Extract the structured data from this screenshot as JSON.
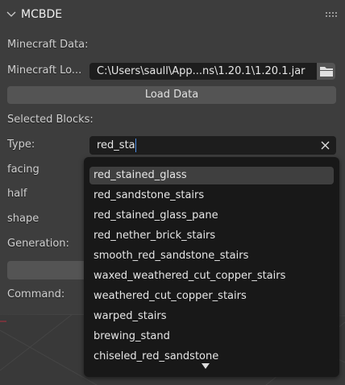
{
  "panel": {
    "title": "MCBDE"
  },
  "minecraft_data_label": "Minecraft Data:",
  "location": {
    "label": "Minecraft Lo...",
    "value": "C:\\Users\\saull\\App...ns\\1.20.1\\1.20.1.jar"
  },
  "load_button": "Load Data",
  "selected_blocks_label": "Selected Blocks:",
  "type": {
    "label": "Type:",
    "value": "red_sta"
  },
  "properties": [
    "facing",
    "half",
    "shape"
  ],
  "generation_label": "Generation:",
  "command_label": "Command:",
  "dropdown": {
    "items": [
      "red_stained_glass",
      "red_sandstone_stairs",
      "red_stained_glass_pane",
      "red_nether_brick_stairs",
      "smooth_red_sandstone_stairs",
      "waxed_weathered_cut_copper_stairs",
      "weathered_cut_copper_stairs",
      "warped_stairs",
      "brewing_stand",
      "chiseled_red_sandstone"
    ]
  }
}
